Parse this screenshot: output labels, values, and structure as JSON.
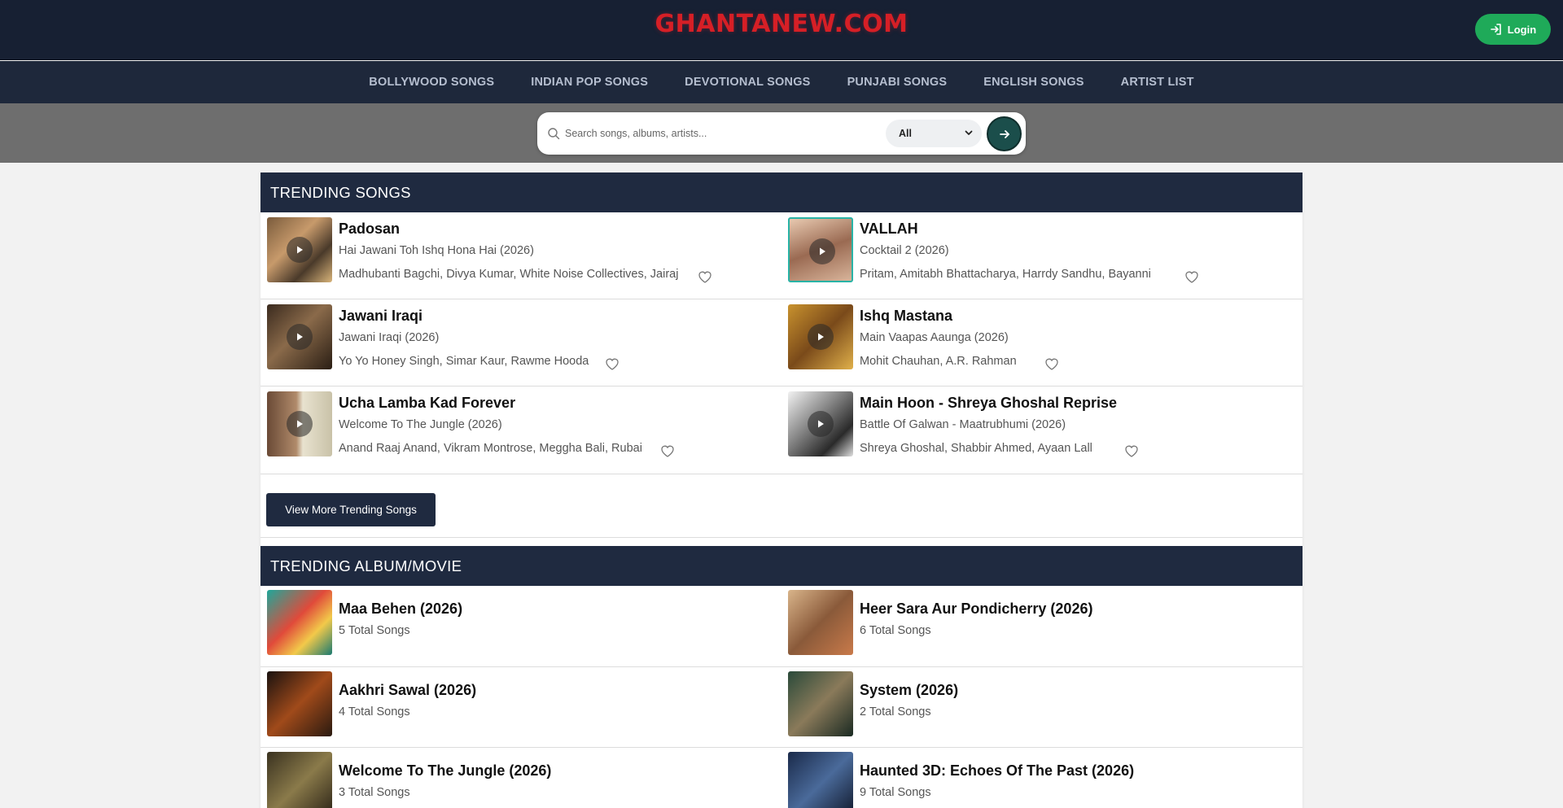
{
  "header": {
    "logo": "GHANTANEW.COM",
    "login_label": "Login"
  },
  "nav": {
    "items": [
      "BOLLYWOOD SONGS",
      "INDIAN POP SONGS",
      "DEVOTIONAL SONGS",
      "PUNJABI SONGS",
      "ENGLISH SONGS",
      "ARTIST LIST"
    ]
  },
  "search": {
    "placeholder": "Search songs, albums, artists...",
    "value": "",
    "category_selected": "All"
  },
  "trending_songs": {
    "title": "TRENDING SONGS",
    "more_label": "View More Trending Songs",
    "items": [
      {
        "title": "Padosan",
        "album": "Hai Jawani Toh Ishq Hona Hai (2026)",
        "artists": "Madhubanti Bagchi, Divya Kumar, White Noise Collectives, Jairaj"
      },
      {
        "title": "VALLAH",
        "album": "Cocktail 2 (2026)",
        "artists": "Pritam, Amitabh Bhattacharya, Harrdy Sandhu, Bayanni"
      },
      {
        "title": "Jawani Iraqi",
        "album": "Jawani Iraqi (2026)",
        "artists": "Yo Yo Honey Singh, Simar Kaur, Rawme Hooda"
      },
      {
        "title": "Ishq Mastana",
        "album": "Main Vaapas Aaunga (2026)",
        "artists": "Mohit Chauhan, A.R. Rahman"
      },
      {
        "title": "Ucha Lamba Kad Forever",
        "album": "Welcome To The Jungle (2026)",
        "artists": "Anand Raaj Anand, Vikram Montrose, Meggha Bali, Rubai"
      },
      {
        "title": "Main Hoon - Shreya Ghoshal Reprise",
        "album": "Battle Of Galwan - Maatrubhumi (2026)",
        "artists": "Shreya Ghoshal, Shabbir Ahmed, Ayaan Lall"
      }
    ]
  },
  "trending_albums": {
    "title": "TRENDING ALBUM/MOVIE",
    "items": [
      {
        "title": "Maa Behen (2026)",
        "count": "5 Total Songs"
      },
      {
        "title": "Heer Sara Aur Pondicherry (2026)",
        "count": "6 Total Songs"
      },
      {
        "title": "Aakhri Sawal (2026)",
        "count": "4 Total Songs"
      },
      {
        "title": "System (2026)",
        "count": "2 Total Songs"
      },
      {
        "title": "Welcome To The Jungle (2026)",
        "count": "3 Total Songs"
      },
      {
        "title": "Haunted 3D: Echoes Of The Past (2026)",
        "count": "9 Total Songs"
      }
    ]
  }
}
